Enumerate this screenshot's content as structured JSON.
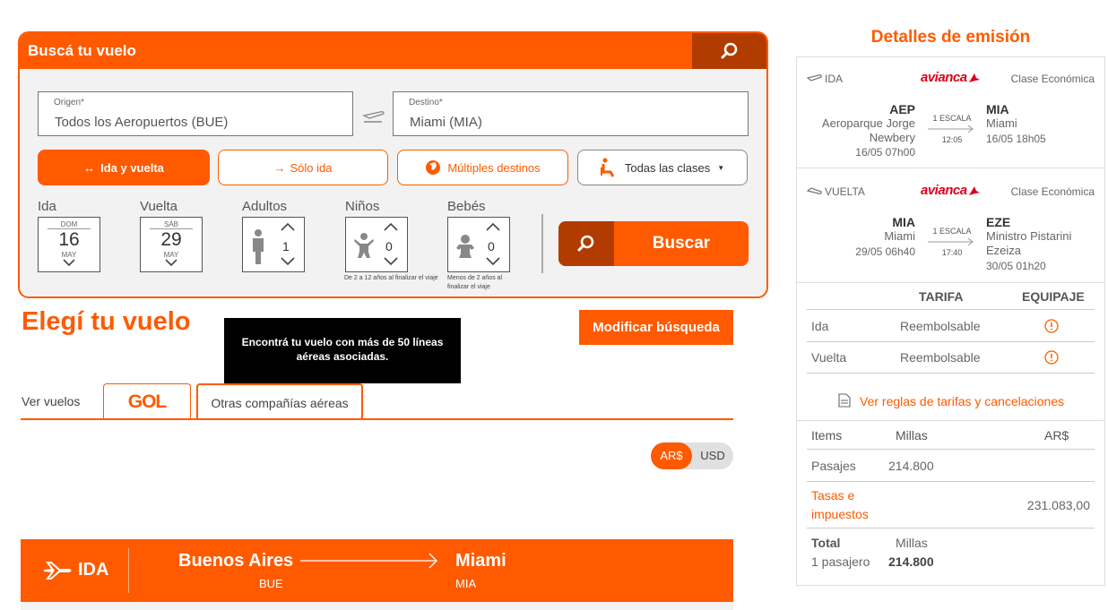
{
  "search": {
    "title": "Buscá tu vuelo",
    "origin_label": "Origen*",
    "origin_value": "Todos los Aeropuertos (BUE)",
    "destination_label": "Destino*",
    "destination_value": "Miami (MIA)",
    "trip_types": [
      "Ida y vuelta",
      "Sólo ida",
      "Múltiples destinos"
    ],
    "trip_type_arrows": [
      "↔",
      "→"
    ],
    "class_select": "Todas las clases",
    "ida_label": "Ida",
    "ida_date": {
      "weekday": "DOM",
      "day": "16",
      "month": "MAY"
    },
    "vuelta_label": "Vuelta",
    "vuelta_date": {
      "weekday": "SÁB",
      "day": "29",
      "month": "MAY"
    },
    "adults_label": "Adultos",
    "adults_value": "1",
    "children_label": "Niños",
    "children_value": "0",
    "children_note": "De 2 a 12 años al finalizar el viaje",
    "babies_label": "Bebés",
    "babies_value": "0",
    "babies_note": "Menos de 2 años al finalizar el viaje",
    "search_button": "Buscar"
  },
  "results": {
    "title": "Elegí tu vuelo",
    "modify_button": "Modificar búsqueda",
    "tooltip": "Encontrá tu vuelo con más de 50 líneas aéreas asociadas.",
    "ver_vuelos": "Ver vuelos",
    "tabs": [
      "GOL",
      "Otras compañías aéreas"
    ],
    "currency": [
      "AR$",
      "USD"
    ],
    "ida_bar": {
      "label": "IDA",
      "from_city": "Buenos Aires",
      "from_code": "BUE",
      "to_city": "Miami",
      "to_code": "MIA"
    }
  },
  "details": {
    "title": "Detalles de emisión",
    "outbound": {
      "label": "IDA",
      "airline": "avianca",
      "class": "Clase Económica",
      "from_code": "AEP",
      "from_name": "Aeroparque Jorge Newbery",
      "from_date": "16/05 07h00",
      "stops": "1 ESCALA",
      "duration": "12:05",
      "to_code": "MIA",
      "to_name": "Miami",
      "to_date": "16/05 18h05"
    },
    "inbound": {
      "label": "VUELTA",
      "airline": "avianca",
      "class": "Clase Económica",
      "from_code": "MIA",
      "from_name": "Miami",
      "from_date": "29/05 06h40",
      "stops": "1 ESCALA",
      "duration": "17:40",
      "to_code": "EZE",
      "to_name": "Ministro Pistarini Ezeiza",
      "to_date": "30/05 01h20"
    },
    "fare_headers": [
      "TARIFA",
      "EQUIPAJE"
    ],
    "fare_rows": [
      {
        "leg": "Ida",
        "fare": "Reembolsable"
      },
      {
        "leg": "Vuelta",
        "fare": "Reembolsable"
      }
    ],
    "rules_link": "Ver reglas de tarifas y cancelaciones",
    "items_headers": [
      "Items",
      "Millas",
      "AR$"
    ],
    "pasajes_label": "Pasajes",
    "pasajes_millas": "214.800",
    "tasas_label_1": "Tasas e",
    "tasas_label_2": "impuestos",
    "tasas_ars": "231.083,00",
    "total_label": "Total",
    "total_sub": "1 pasajero",
    "total_millas_label": "Millas",
    "total_millas": "214.800"
  },
  "colors": {
    "accent": "#ff5a00",
    "accent_dark": "#b23b00",
    "airline_red": "#e0001b"
  }
}
